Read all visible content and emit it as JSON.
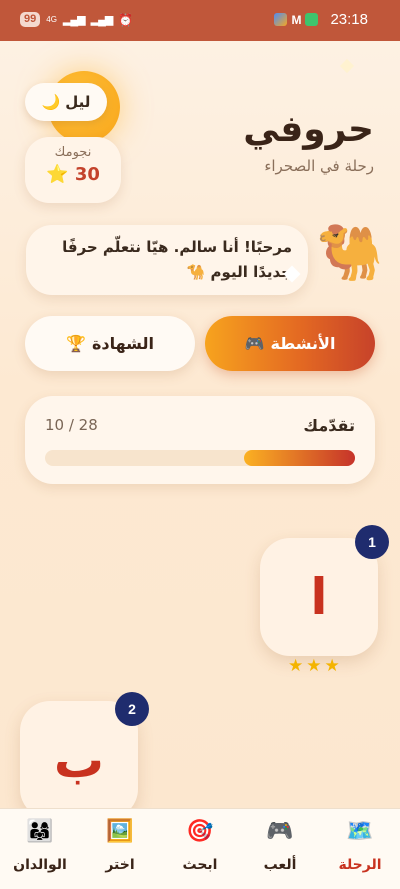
{
  "status_bar": {
    "battery": "99",
    "network": "4G",
    "time": "23:18"
  },
  "header": {
    "night_toggle_icon": "🌙",
    "night_toggle_label": "ليل",
    "stars_label": "نجومك",
    "stars_icon": "⭐",
    "stars_count": "30",
    "title": "حروفي",
    "subtitle": "رحلة في الصحراء"
  },
  "greeting": {
    "line1": "مرحبًا! أنا سالم. هيّا نتعلّم حرفًا",
    "line2": "جديدًا اليوم 🐪",
    "mascot_icon": "🐫"
  },
  "buttons": {
    "activities_icon": "🎮",
    "activities_label": "الأنشطة",
    "certificate_icon": "🏆",
    "certificate_label": "الشهادة"
  },
  "progress": {
    "label": "تقدّمك",
    "count_text": "10 / 28",
    "fraction": 0.357
  },
  "levels": [
    {
      "number": "1",
      "letter": "ا",
      "stars": "★★★"
    },
    {
      "number": "2",
      "letter": "ب"
    }
  ],
  "bottom_nav": [
    {
      "icon": "🗺️",
      "label": "الرحلة",
      "active": true
    },
    {
      "icon": "🎮",
      "label": "ألعب"
    },
    {
      "icon": "🎯",
      "label": "ابحث"
    },
    {
      "icon": "🖼️",
      "label": "اختر"
    },
    {
      "icon": "👨‍👩‍👧",
      "label": "الوالدان"
    }
  ],
  "colors": {
    "status_bar": "#c0573a",
    "accent_red": "#c8321f",
    "badge_navy": "#1f2c6e",
    "star_gold": "#f4b400"
  }
}
